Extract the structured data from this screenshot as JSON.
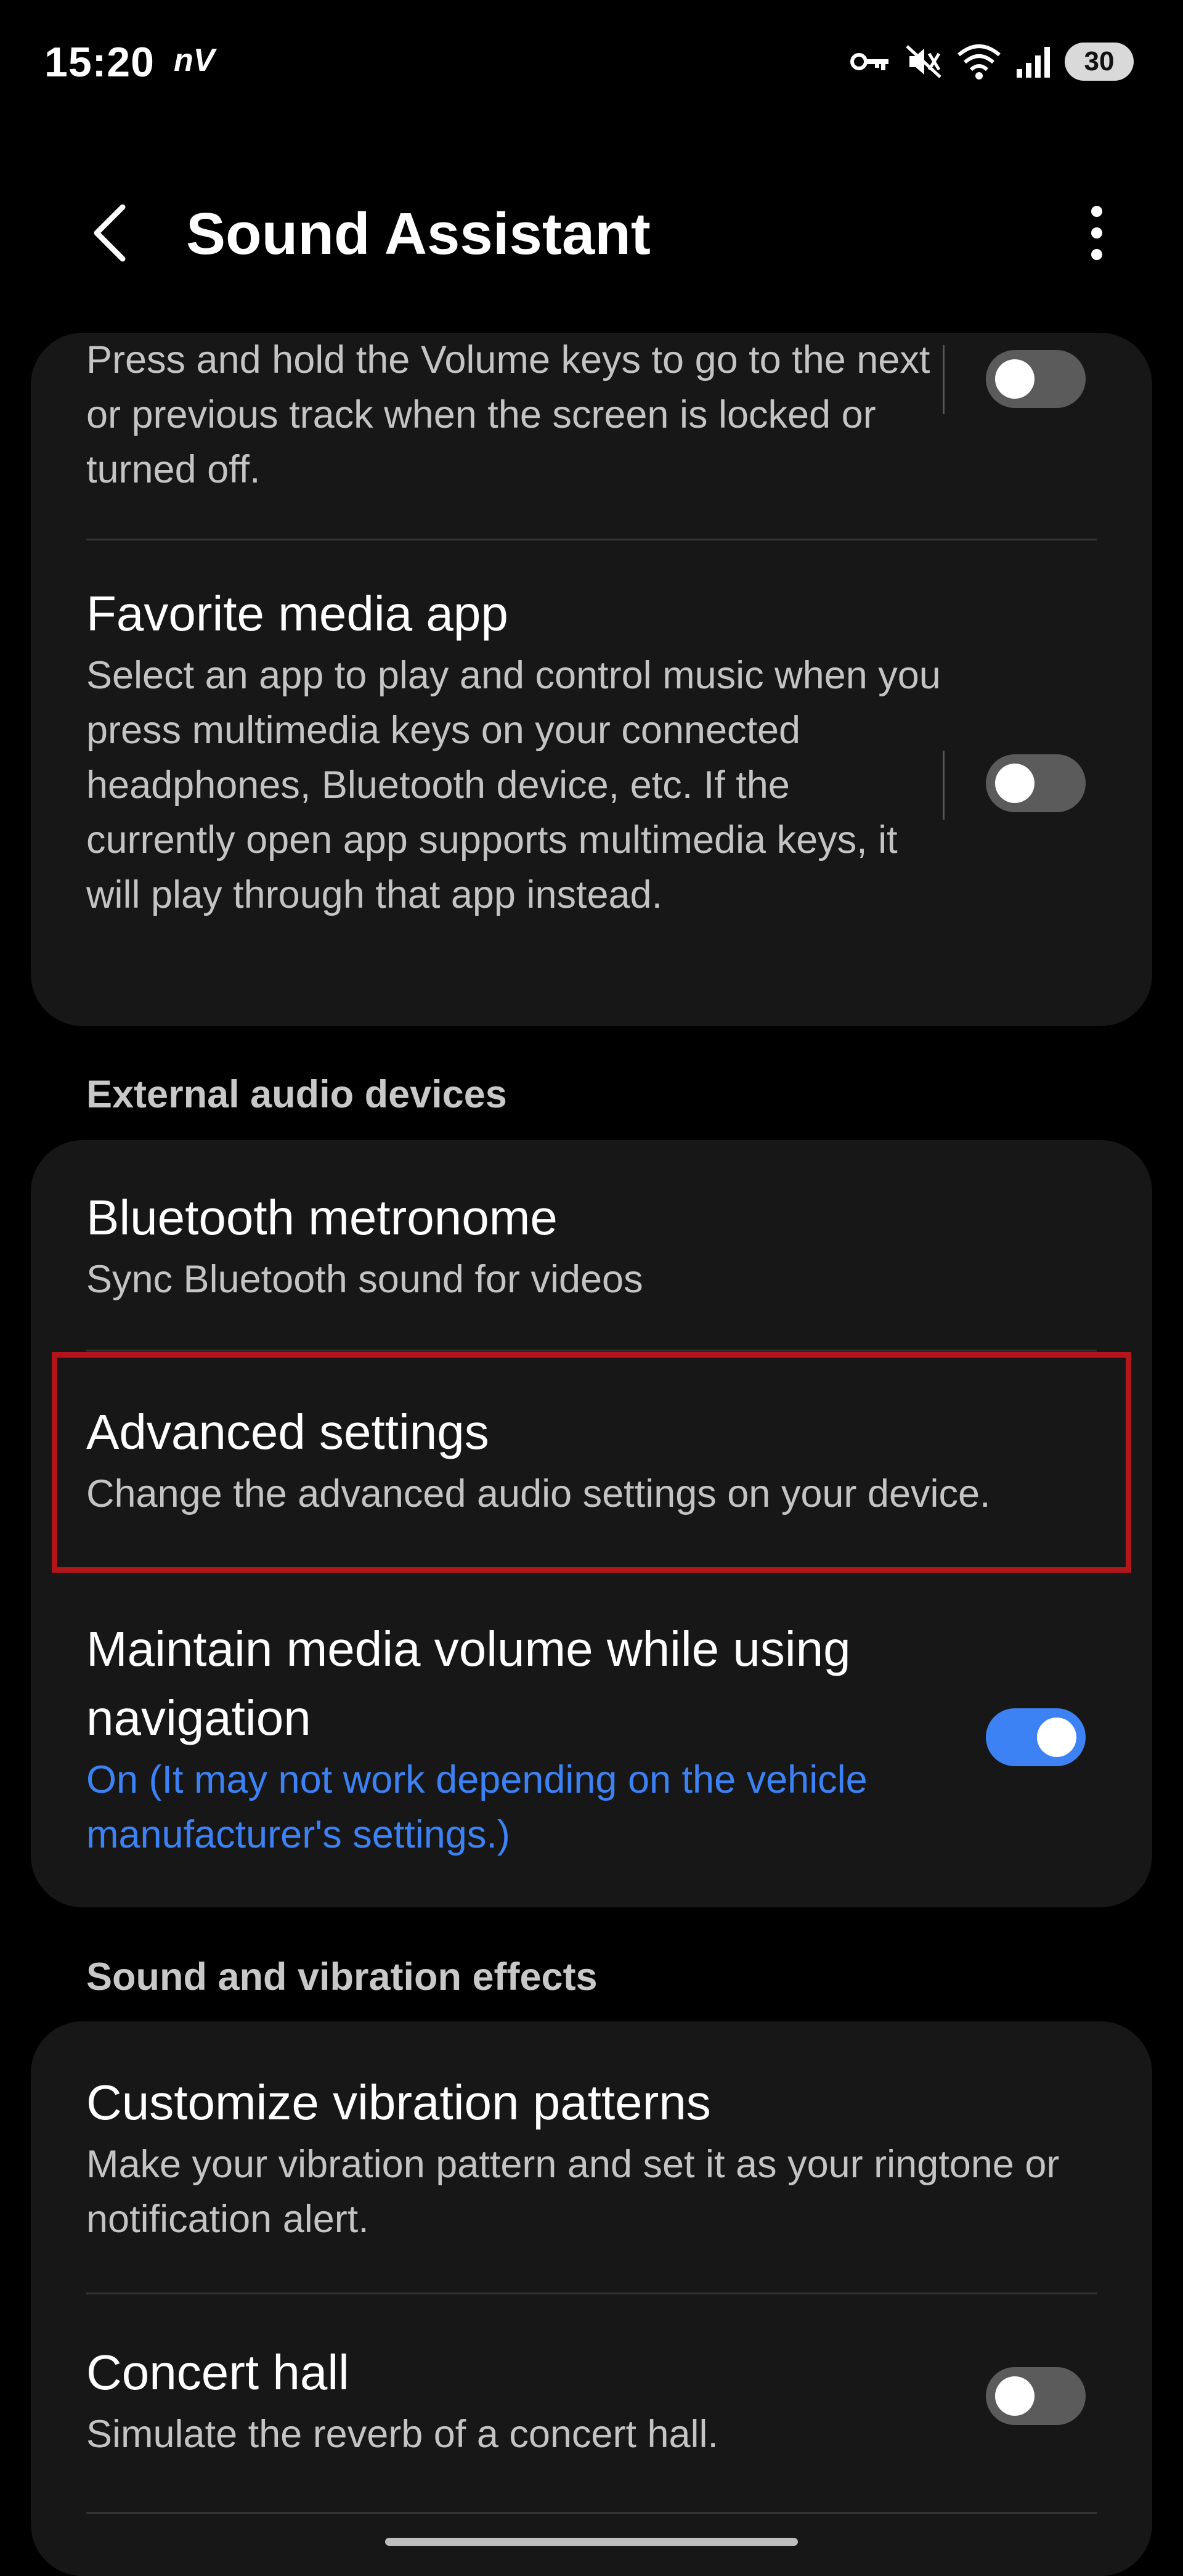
{
  "status_bar": {
    "time": "15:20",
    "carrier": "nV",
    "battery": "30",
    "icons": [
      "vpn-key-icon",
      "mute-vibrate-icon",
      "wifi-icon",
      "signal-icon",
      "battery-icon"
    ]
  },
  "header": {
    "title": "Sound Assistant",
    "back_icon": "back-chevron-icon",
    "more_icon": "more-vertical-icon"
  },
  "sections": {
    "top": {
      "rows": [
        {
          "desc": "Press and hold the Volume keys to go to the next or previous track when the screen is locked or turned off.",
          "toggle": false
        },
        {
          "title": "Favorite media app",
          "desc": "Select an app to play and control music when you press multimedia keys on your connected headphones, Bluetooth device, etc. If the currently open app supports multimedia keys, it will play through that app instead.",
          "toggle": false
        }
      ]
    },
    "external_audio": {
      "header": "External audio devices",
      "rows": [
        {
          "title": "Bluetooth metronome",
          "desc": "Sync Bluetooth sound for videos"
        },
        {
          "title": "Advanced settings",
          "desc": "Change the advanced audio settings on your device."
        },
        {
          "title": "Maintain media volume while using navigation",
          "desc": "On (It may not work depending on the vehicle manufacturer's settings.)",
          "toggle": true
        }
      ]
    },
    "sound_vibration": {
      "header": "Sound and vibration effects",
      "rows": [
        {
          "title": "Customize vibration patterns",
          "desc": "Make your vibration pattern and set it as your ringtone or notification alert."
        },
        {
          "title": "Concert hall",
          "desc": "Simulate the reverb of a concert hall.",
          "toggle": false
        }
      ]
    }
  },
  "colors": {
    "background": "#000000",
    "card": "#171717",
    "accent": "#3d82f5",
    "highlight": "#b3151d",
    "secondary_text": "#c4c4c4"
  }
}
